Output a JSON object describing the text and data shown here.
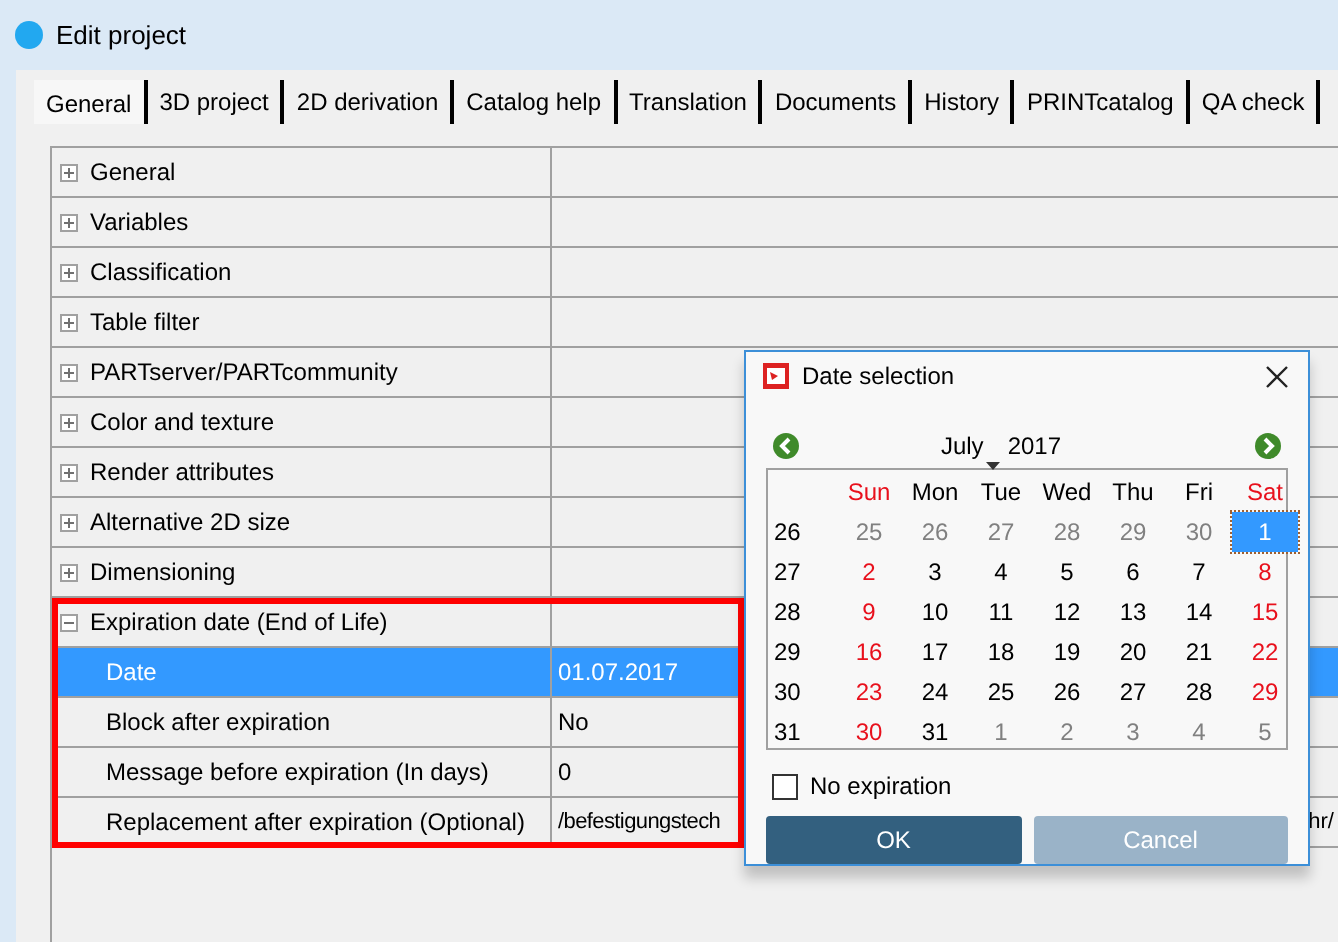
{
  "window": {
    "title": "Edit project"
  },
  "tabs": [
    {
      "label": "General",
      "selected": true
    },
    {
      "label": "3D project",
      "selected": false
    },
    {
      "label": "2D derivation",
      "selected": false
    },
    {
      "label": "Catalog help",
      "selected": false
    },
    {
      "label": "Translation",
      "selected": false
    },
    {
      "label": "Documents",
      "selected": false
    },
    {
      "label": "History",
      "selected": false
    },
    {
      "label": "PRINTcatalog",
      "selected": false
    },
    {
      "label": "QA check",
      "selected": false
    }
  ],
  "properties": [
    {
      "label": "General",
      "expanded": false,
      "highlighted": false
    },
    {
      "label": "Variables",
      "expanded": false,
      "highlighted": false
    },
    {
      "label": "Classification",
      "expanded": false,
      "highlighted": false
    },
    {
      "label": "Table filter",
      "expanded": false,
      "highlighted": false
    },
    {
      "label": "PARTserver/PARTcommunity",
      "expanded": false,
      "highlighted": false
    },
    {
      "label": "Color and texture",
      "expanded": false,
      "highlighted": false
    },
    {
      "label": "Render attributes",
      "expanded": false,
      "highlighted": false
    },
    {
      "label": "Alternative 2D size",
      "expanded": false,
      "highlighted": false
    },
    {
      "label": "Dimensioning",
      "expanded": false,
      "highlighted": false
    },
    {
      "label": "Expiration date (End of Life)",
      "expanded": true,
      "highlighted": true,
      "children": [
        {
          "label": "Date",
          "value": "01.07.2017",
          "selected": true
        },
        {
          "label": "Block after expiration",
          "value": "No",
          "selected": false
        },
        {
          "label": "Message before expiration (In days)",
          "value": "0",
          "selected": false
        },
        {
          "label": "Replacement after expiration (Optional)",
          "value": "/befestigungstech",
          "value_end": "hr/",
          "selected": false
        }
      ]
    }
  ],
  "dialog": {
    "title": "Date selection",
    "month": "July",
    "year": "2017",
    "weekdays": [
      {
        "label": "Sun",
        "kind": "weekend"
      },
      {
        "label": "Mon",
        "kind": "weekday"
      },
      {
        "label": "Tue",
        "kind": "weekday"
      },
      {
        "label": "Wed",
        "kind": "weekday"
      },
      {
        "label": "Thu",
        "kind": "weekday"
      },
      {
        "label": "Fri",
        "kind": "weekday"
      },
      {
        "label": "Sat",
        "kind": "weekend"
      }
    ],
    "weeks": [
      {
        "number": "26",
        "days": [
          {
            "label": "25",
            "kind": "other",
            "selected": false
          },
          {
            "label": "26",
            "kind": "other",
            "selected": false
          },
          {
            "label": "27",
            "kind": "other",
            "selected": false
          },
          {
            "label": "28",
            "kind": "other",
            "selected": false
          },
          {
            "label": "29",
            "kind": "other",
            "selected": false
          },
          {
            "label": "30",
            "kind": "other",
            "selected": false
          },
          {
            "label": "1",
            "kind": "weekend",
            "selected": true
          }
        ]
      },
      {
        "number": "27",
        "days": [
          {
            "label": "2",
            "kind": "weekend",
            "selected": false
          },
          {
            "label": "3",
            "kind": "weekday",
            "selected": false
          },
          {
            "label": "4",
            "kind": "weekday",
            "selected": false
          },
          {
            "label": "5",
            "kind": "weekday",
            "selected": false
          },
          {
            "label": "6",
            "kind": "weekday",
            "selected": false
          },
          {
            "label": "7",
            "kind": "weekday",
            "selected": false
          },
          {
            "label": "8",
            "kind": "weekend",
            "selected": false
          }
        ]
      },
      {
        "number": "28",
        "days": [
          {
            "label": "9",
            "kind": "weekend",
            "selected": false
          },
          {
            "label": "10",
            "kind": "weekday",
            "selected": false
          },
          {
            "label": "11",
            "kind": "weekday",
            "selected": false
          },
          {
            "label": "12",
            "kind": "weekday",
            "selected": false
          },
          {
            "label": "13",
            "kind": "weekday",
            "selected": false
          },
          {
            "label": "14",
            "kind": "weekday",
            "selected": false
          },
          {
            "label": "15",
            "kind": "weekend",
            "selected": false
          }
        ]
      },
      {
        "number": "29",
        "days": [
          {
            "label": "16",
            "kind": "weekend",
            "selected": false
          },
          {
            "label": "17",
            "kind": "weekday",
            "selected": false
          },
          {
            "label": "18",
            "kind": "weekday",
            "selected": false
          },
          {
            "label": "19",
            "kind": "weekday",
            "selected": false
          },
          {
            "label": "20",
            "kind": "weekday",
            "selected": false
          },
          {
            "label": "21",
            "kind": "weekday",
            "selected": false
          },
          {
            "label": "22",
            "kind": "weekend",
            "selected": false
          }
        ]
      },
      {
        "number": "30",
        "days": [
          {
            "label": "23",
            "kind": "weekend",
            "selected": false
          },
          {
            "label": "24",
            "kind": "weekday",
            "selected": false
          },
          {
            "label": "25",
            "kind": "weekday",
            "selected": false
          },
          {
            "label": "26",
            "kind": "weekday",
            "selected": false
          },
          {
            "label": "27",
            "kind": "weekday",
            "selected": false
          },
          {
            "label": "28",
            "kind": "weekday",
            "selected": false
          },
          {
            "label": "29",
            "kind": "weekend",
            "selected": false
          }
        ]
      },
      {
        "number": "31",
        "days": [
          {
            "label": "30",
            "kind": "weekend",
            "selected": false
          },
          {
            "label": "31",
            "kind": "weekday",
            "selected": false
          },
          {
            "label": "1",
            "kind": "other",
            "selected": false
          },
          {
            "label": "2",
            "kind": "other",
            "selected": false
          },
          {
            "label": "3",
            "kind": "other",
            "selected": false
          },
          {
            "label": "4",
            "kind": "other",
            "selected": false
          },
          {
            "label": "5",
            "kind": "other",
            "selected": false
          }
        ]
      }
    ],
    "no_expiration": {
      "label": "No expiration",
      "checked": false
    },
    "buttons": [
      {
        "label": "OK",
        "kind": "primary"
      },
      {
        "label": "Cancel",
        "kind": "secondary"
      }
    ]
  }
}
